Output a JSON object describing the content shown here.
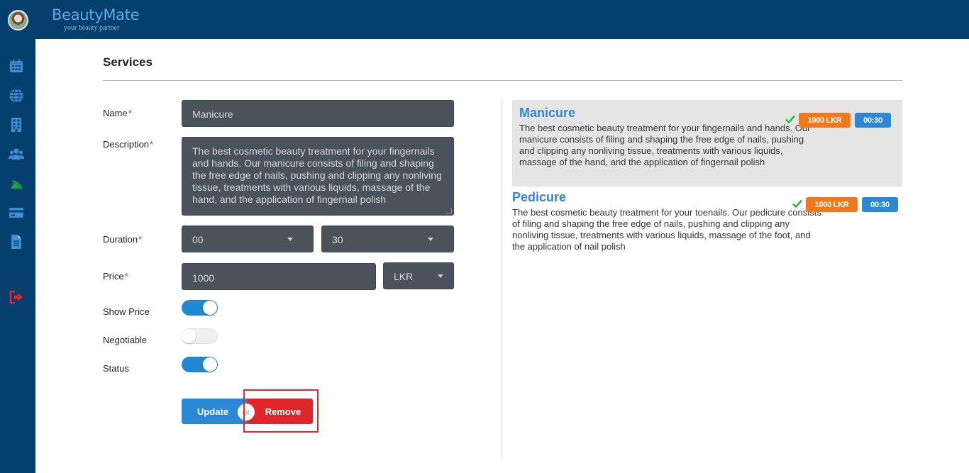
{
  "app": {
    "brand": "BeautyMate",
    "tagline": "your beauty partner"
  },
  "sidebar": {
    "icons": [
      "calendar-icon",
      "globe-icon",
      "building-icon",
      "users-icon",
      "leaf-icon",
      "credit-card-icon",
      "document-icon",
      "logout-icon"
    ]
  },
  "page": {
    "title": "Services"
  },
  "form": {
    "name_label": "Name",
    "name_value": "Manicure",
    "description_label": "Description",
    "description_value": "The best cosmetic beauty treatment for your fingernails and hands. Our manicure consists of filing and shaping the free edge of nails, pushing and clipping any nonliving tissue, treatments with various liquids, massage of the hand, and the application of fingernail polish",
    "duration_label": "Duration",
    "duration_hours": "00",
    "duration_minutes": "30",
    "price_label": "Price",
    "price_value": "1000",
    "currency": "LKR",
    "show_price_label": "Show Price",
    "show_price_on": true,
    "negotiable_label": "Negotiable",
    "negotiable_on": false,
    "status_label": "Status",
    "status_on": true,
    "required_mark": "*",
    "update_label": "Update",
    "or_label": "or",
    "remove_label": "Remove"
  },
  "services": [
    {
      "name": "Manicure",
      "description": "The best cosmetic beauty treatment for your fingernails and hands. Our manicure consists of filing and shaping the free edge of nails, pushing and clipping any nonliving tissue, treatments with various liquids, massage of the hand, and the application of fingernail polish",
      "price": "1000 LKR",
      "duration": "00:30",
      "selected": true
    },
    {
      "name": "Pedicure",
      "description": "The best cosmetic beauty treatment for your toenails. Our pedicure consists of filing and shaping the free edge of nails, pushing and clipping any nonliving tissue, treatments with various liquids, massage of the foot, and the application of nail polish",
      "price": "1000 LKR",
      "duration": "00:30",
      "selected": false
    }
  ],
  "colors": {
    "header_bg": "#053f6d",
    "accent_blue": "#2a88d5",
    "danger_red": "#e0262a",
    "price_orange": "#f0791e",
    "check_green": "#2fb84a"
  }
}
